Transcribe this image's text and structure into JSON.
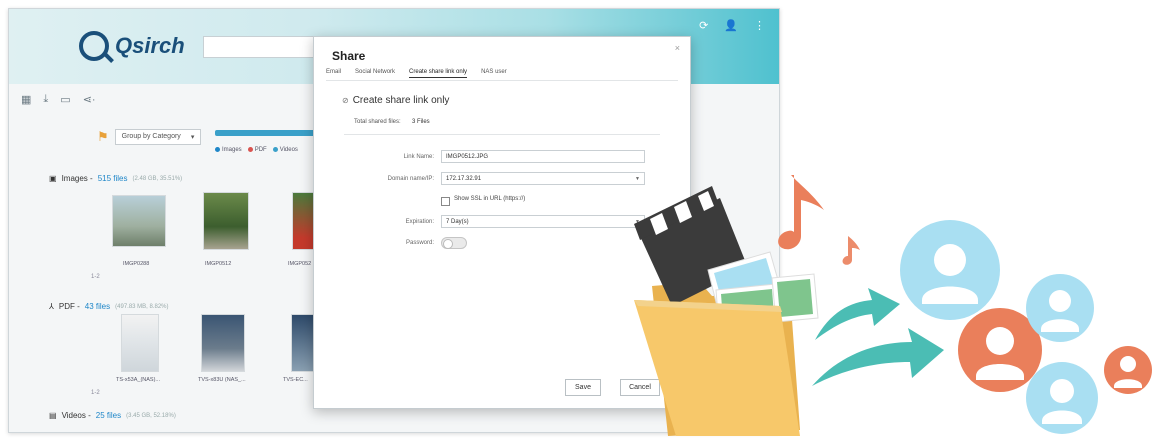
{
  "app": {
    "logo_text": "Qsirch",
    "toolbar_icons": [
      "grid-icon",
      "download-icon",
      "folder-icon",
      "share-icon"
    ],
    "header_icons": [
      "refresh-icon",
      "user-icon",
      "more-icon"
    ]
  },
  "filters": {
    "group_by": "Group by Category",
    "legend": [
      "Images",
      "PDF",
      "Videos"
    ],
    "legend_colors": [
      "#1e86c8",
      "#d9534f",
      "#3aa0c9"
    ]
  },
  "sections": {
    "images": {
      "label": "Images -",
      "count": "515 files",
      "meta": "(2.48 GB, 35.51%)"
    },
    "pdf": {
      "label": "PDF -",
      "count": "43 files",
      "meta": "(497.83 MB, 8.82%)"
    },
    "videos": {
      "label": "Videos -",
      "count": "25 files",
      "meta": "(3.45 GB, 52.18%)"
    }
  },
  "image_captions": [
    "IMGP0288",
    "IMGP0512",
    "IMGP052"
  ],
  "pdf_captions": [
    "TS-x53A_(NAS)...",
    "TVS-x83U (NAS_...",
    "TVS-EC..."
  ],
  "pager": "1-2",
  "dialog": {
    "title": "Share",
    "close": "×",
    "tabs": [
      "Email",
      "Social Network",
      "Create share link only",
      "NAS user"
    ],
    "active_tab": 2,
    "section_title": "Create share link only",
    "total_label": "Total shared files:",
    "total_value": "3 Files",
    "link_name_label": "Link Name:",
    "link_name_value": "IMGP0512.JPG",
    "domain_label": "Domain name/IP:",
    "domain_value": "172.17.32.91",
    "ssl_label": "Show SSL in URL (https://)",
    "expiration_label": "Expiration:",
    "expiration_value": "7 Day(s)",
    "password_label": "Password:",
    "save_label": "Save",
    "cancel_label": "Cancel"
  },
  "colors": {
    "accent": "#1e6f9f",
    "folder": "#f7c86a",
    "arrow": "#4bbdb4",
    "person_blue": "#a9dff2",
    "person_orange": "#ea7f5b"
  }
}
